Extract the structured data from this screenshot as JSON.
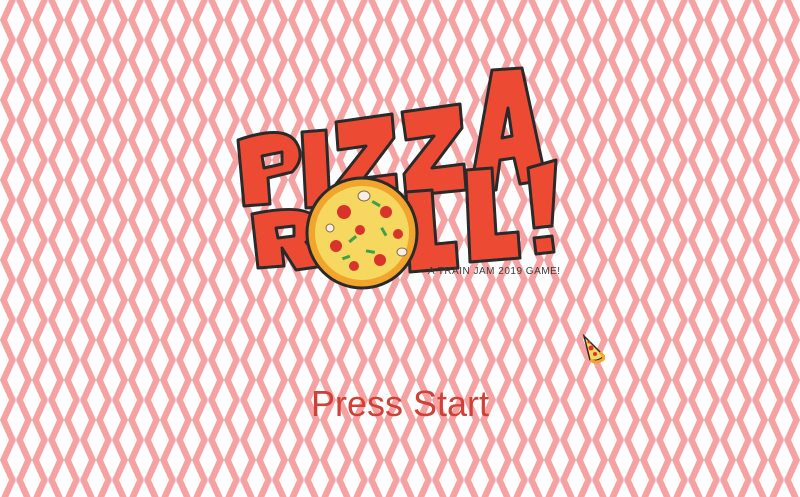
{
  "game": {
    "title_line1": "PIZZA",
    "title_line2": "ROLL!",
    "subtitle": "A TRAIN JAM 2019 GAME!",
    "press_start": "Press Start"
  },
  "colors": {
    "background_pink": "#f6a2a3",
    "diamond_white": "#ffffff",
    "logo_red": "#ec4a33",
    "logo_outline": "#2a2a2a",
    "press_start_text": "#cf4036",
    "pizza_crust": "#f2a52c",
    "pizza_cheese": "#f6d860",
    "pepperoni": "#d9342b"
  },
  "icons": {
    "cursor": "pizza-slice-icon",
    "logo_pizza": "pizza-icon"
  }
}
